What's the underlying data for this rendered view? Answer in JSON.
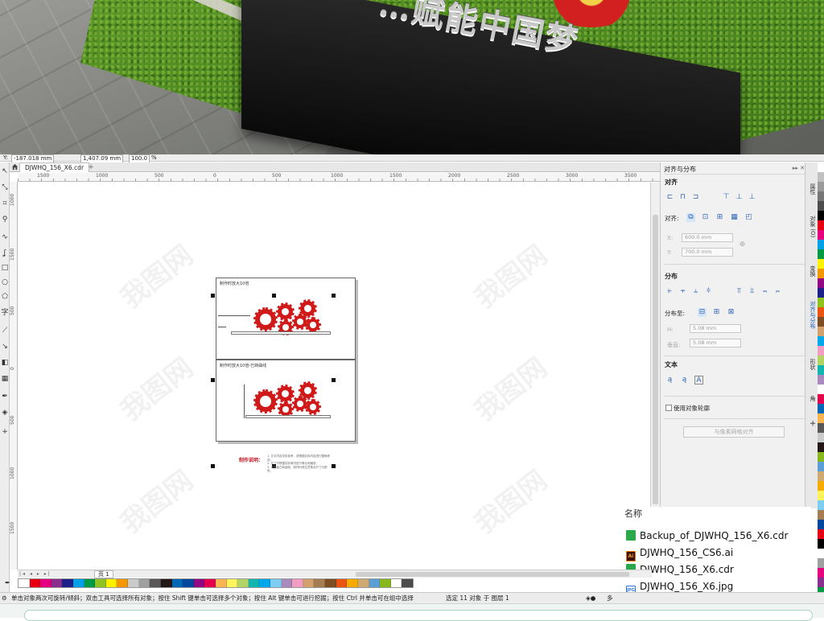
{
  "photo": {
    "sign_text": "…赋能中国梦"
  },
  "propbar": {
    "y_label": "Y:",
    "y_value": "-187.018 mm",
    "size_value": "1,407.09 mm",
    "scale_value": "100.0",
    "scale_unit": "%"
  },
  "tabs": {
    "document_tab": "DJWHQ_156_X6.cdr",
    "add_tab": "+"
  },
  "ruler": {
    "h_ticks": [
      "1500",
      "1000",
      "500",
      "0",
      "500",
      "1000",
      "1500",
      "2000",
      "2500",
      "3000",
      "3500"
    ],
    "v_ticks": [
      "1000",
      "1500",
      "500",
      "0",
      "500",
      "1000",
      "1500"
    ]
  },
  "canvas": {
    "sheet1_title": "制作时放大10倍",
    "sheet2_title": "制作时放大10倍-已转曲线",
    "note_label": "制作说明：",
    "note_lines": [
      "1. 文字内容仅供参考，请根据实际内容进行替换修改；",
      "2. 尺寸可根据实际情况进行等比例缩放；",
      "3. 本模板已转曲线，制作时请注意核对尺寸与颜色。"
    ],
    "watermark_text": "我图网"
  },
  "docker": {
    "title": "对齐与分布",
    "section_align": "对齐",
    "align_to_label": "对齐:",
    "x_label": "X:",
    "x_value": "600.0 mm",
    "y_label": "Y:",
    "y_value": "700.0 mm",
    "section_distribute": "分布",
    "distribute_to_label": "分布至:",
    "h_label": "H:",
    "h_value": "5.08 mm",
    "v_label": "垂直:",
    "v_value": "5.08 mm",
    "section_text": "文本",
    "use_outline_label": "使用对象轮廓",
    "pixel_grid_button": "与像素网格对齐"
  },
  "dock_tabs": [
    "属性",
    "对象 (O)",
    "变换",
    "对齐与分布",
    "形状",
    "角"
  ],
  "page_tab": "页 1",
  "status": {
    "hint": "单击对象两次可旋转/倾斜；双击工具可选择所有对象；按住 Shift 键单击可选择多个对象；按住 Alt 键单击可进行挖掘；按住 Ctrl 并单击可在组中选择",
    "selection": "选定 11 对象 于 图层 1",
    "fill_label": "多"
  },
  "files": {
    "header": "名称",
    "items": [
      {
        "name": "Backup_of_DJWHQ_156_X6.cdr",
        "icon": "cdr-file-icon"
      },
      {
        "name": "DJWHQ_156_CS6.ai",
        "icon": "ai-file-icon",
        "badge": "Ai"
      },
      {
        "name": "DJWHQ_156_X6.cdr",
        "icon": "cdr-file-icon"
      },
      {
        "name": "DJWHQ_156_X6.jpg",
        "icon": "jpg-file-icon",
        "badge": "JPG"
      }
    ]
  },
  "palette_colors": [
    "#ffffff",
    "#e60012",
    "#e4007f",
    "#8b2f8f",
    "#1d2088",
    "#00a0e9",
    "#009944",
    "#8fc31f",
    "#fff100",
    "#f39800",
    "#c9caca",
    "#9fa0a0",
    "#595757",
    "#231815",
    "#0068b7",
    "#00479d",
    "#920783",
    "#e5004f",
    "#f8b551",
    "#fff45c",
    "#b3d465",
    "#13b5b1",
    "#00a7eb",
    "#7ecef4",
    "#aa89bd",
    "#f19ec2",
    "#d3a16d",
    "#a67c52",
    "#7d4e24",
    "#ea5514",
    "#f6ab00",
    "#cfa972",
    "#5c9fd6",
    "#86b81b",
    "#ffffff",
    "#4d4d4d"
  ],
  "side_palette": [
    "#ffffff",
    "#c0c0c0",
    "#9a9a9a",
    "#767676",
    "#4d4d4d",
    "#000000",
    "#e60012",
    "#e4007f",
    "#00a0e9",
    "#009944",
    "#fff100",
    "#f39800",
    "#920783",
    "#1d2088",
    "#8fc31f",
    "#ea5514",
    "#7d4e24",
    "#d3a16d",
    "#00a7eb",
    "#f19ec2",
    "#b3d465",
    "#13b5b1",
    "#aa89bd",
    "#ffffff",
    "#e5004f",
    "#0068b7",
    "#f8b551",
    "#595757",
    "#c9caca",
    "#231815",
    "#86b81b",
    "#5c9fd6",
    "#cfa972",
    "#f6ab00",
    "#fff45c",
    "#7ecef4",
    "#a67c52",
    "#00479d",
    "#e60012",
    "#000000",
    "#ffffff",
    "#9fa0a0",
    "#e4007f",
    "#8b2f8f",
    "#009944",
    "#fff100",
    "#f39800"
  ]
}
